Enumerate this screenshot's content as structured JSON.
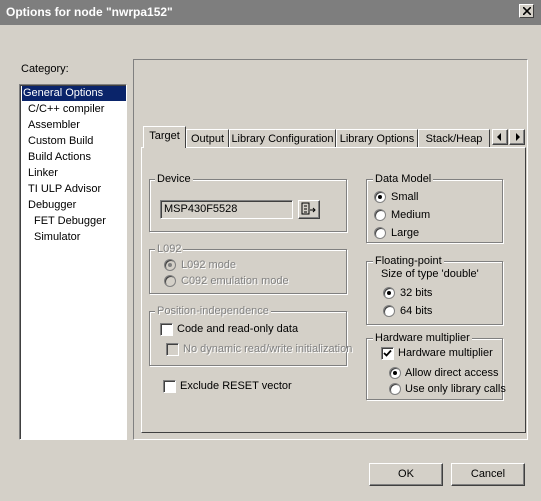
{
  "window": {
    "title": "Options for node \"nwrpa152\""
  },
  "category": {
    "label": "Category:",
    "items": [
      {
        "label": "General Options",
        "indent": 0,
        "selected": true
      },
      {
        "label": "C/C++ compiler",
        "indent": 1
      },
      {
        "label": "Assembler",
        "indent": 1
      },
      {
        "label": "Custom Build",
        "indent": 1
      },
      {
        "label": "Build Actions",
        "indent": 1
      },
      {
        "label": "Linker",
        "indent": 1
      },
      {
        "label": "TI ULP Advisor",
        "indent": 1
      },
      {
        "label": "Debugger",
        "indent": 1
      },
      {
        "label": "FET Debugger",
        "indent": 2
      },
      {
        "label": "Simulator",
        "indent": 2
      }
    ]
  },
  "tabs": [
    "Target",
    "Output",
    "Library Configuration",
    "Library Options",
    "Stack/Heap"
  ],
  "device": {
    "legend": "Device",
    "value": "MSP430F5528"
  },
  "l092": {
    "legend": "L092",
    "options": [
      "L092 mode",
      "C092 emulation mode"
    ]
  },
  "position": {
    "legend": "Position-independence",
    "code_label": "Code and read-only data",
    "nodyn_label": "No dynamic read/write initialization"
  },
  "exclude_reset": {
    "label": "Exclude RESET vector"
  },
  "data_model": {
    "legend": "Data Model",
    "options": [
      "Small",
      "Medium",
      "Large"
    ],
    "selected": "Small"
  },
  "floating_point": {
    "legend": "Floating-point",
    "size_label": "Size of type 'double'",
    "options": [
      "32 bits",
      "64 bits"
    ],
    "selected": "32 bits"
  },
  "hw_mult": {
    "legend": "Hardware multiplier",
    "check_label": "Hardware multiplier",
    "options": [
      "Allow direct access",
      "Use only library calls"
    ],
    "selected": "Allow direct access"
  },
  "buttons": {
    "ok": "OK",
    "cancel": "Cancel"
  },
  "colors": {
    "titlebar": "#7e7e7e",
    "selection": "#0a246a",
    "face": "#d4d0c8"
  }
}
